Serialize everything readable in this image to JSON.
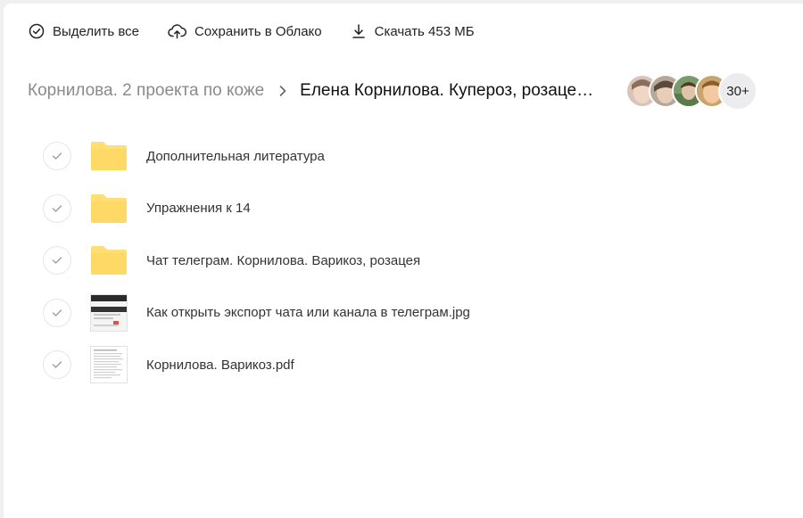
{
  "toolbar": {
    "select_all": "Выделить все",
    "save_cloud": "Сохранить в Облако",
    "download": "Скачать 453 МБ"
  },
  "breadcrumb": {
    "parent": "Корнилова. 2 проекта по коже",
    "current": "Елена Корнилова. Купероз, розаце…"
  },
  "avatars": {
    "more_label": "30+"
  },
  "files": [
    {
      "name": "Дополнительная литература",
      "icon": "folder-icon"
    },
    {
      "name": "Упражнения к 14",
      "icon": "folder-icon"
    },
    {
      "name": "Чат телеграм. Корнилова. Варикоз, розацея",
      "icon": "folder-icon"
    },
    {
      "name": "Как открыть экспорт чата или канала в телеграм.jpg",
      "icon": "image-thumbnail"
    },
    {
      "name": "Корнилова. Варикоз.pdf",
      "icon": "pdf-thumbnail"
    }
  ],
  "colors": {
    "folder": "#ffd966",
    "muted_text": "#8a8a8a",
    "accent_check": "#999999"
  }
}
